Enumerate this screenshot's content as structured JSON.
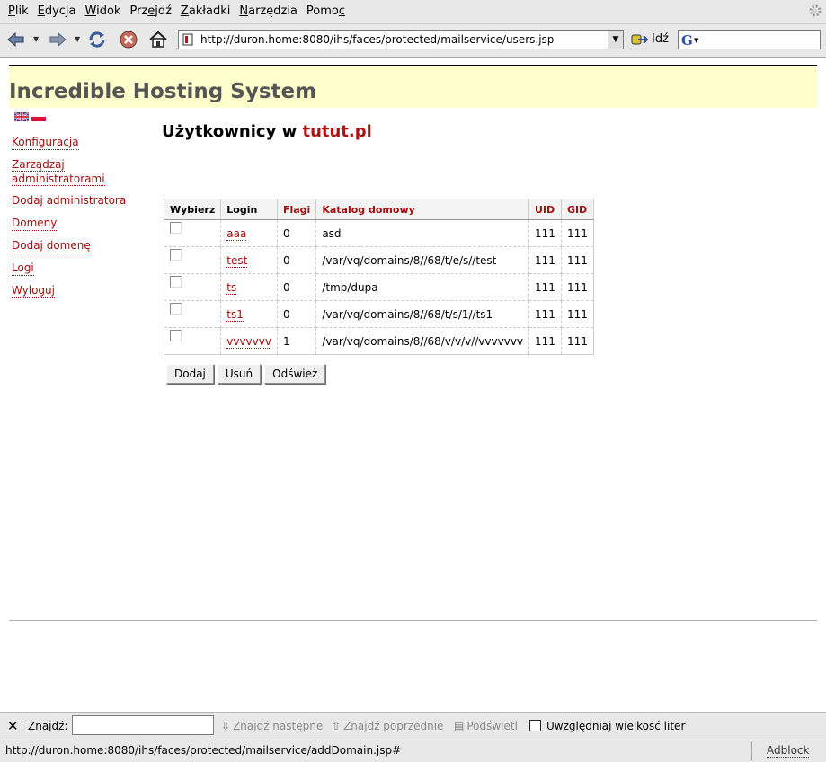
{
  "browser": {
    "menu": [
      {
        "pre": "",
        "u": "P",
        "post": "lik"
      },
      {
        "pre": "",
        "u": "E",
        "post": "dycja"
      },
      {
        "pre": "",
        "u": "W",
        "post": "idok"
      },
      {
        "pre": "Prz",
        "u": "e",
        "post": "jdź"
      },
      {
        "pre": "",
        "u": "Z",
        "post": "akładki"
      },
      {
        "pre": "",
        "u": "N",
        "post": "arzędzia"
      },
      {
        "pre": "Pomo",
        "u": "c",
        "post": ""
      }
    ],
    "url": "http://duron.home:8080/ihs/faces/protected/mailservice/users.jsp",
    "go_label": "Idź",
    "search_engine_glyph": "G",
    "icons": [
      "back-icon",
      "forward-icon",
      "reload-icon",
      "stop-icon",
      "home-icon",
      "throbber-icon"
    ]
  },
  "site": {
    "title": "Incredible Hosting System",
    "languages": [
      "en",
      "pl"
    ]
  },
  "sidebar": {
    "items": [
      {
        "label": "Konfiguracja",
        "name": "konfiguracja"
      },
      {
        "label": "Zarządzaj administratorami",
        "name": "zarzadzaj-administratorami"
      },
      {
        "label": "Dodaj administratora",
        "name": "dodaj-administratora"
      },
      {
        "label": "Domeny",
        "name": "domeny"
      },
      {
        "label": "Dodaj domenę",
        "name": "dodaj-domene"
      },
      {
        "label": "Logi",
        "name": "logi"
      },
      {
        "label": "Wyloguj",
        "name": "wyloguj"
      }
    ]
  },
  "main": {
    "title_prefix": "Użytkownicy w ",
    "domain": "tutut.pl",
    "columns": [
      "Wybierz",
      "Login",
      "Flagi",
      "Katalog domowy",
      "UID",
      "GID"
    ],
    "rows": [
      {
        "login": "aaa",
        "flags": "0",
        "home": "asd",
        "uid": "111",
        "gid": "111"
      },
      {
        "login": "test",
        "flags": "0",
        "home": "/var/vq/domains/8//68/t/e/s//test",
        "uid": "111",
        "gid": "111"
      },
      {
        "login": "ts",
        "flags": "0",
        "home": "/tmp/dupa",
        "uid": "111",
        "gid": "111"
      },
      {
        "login": "ts1",
        "flags": "0",
        "home": "/var/vq/domains/8//68/t/s/1//ts1",
        "uid": "111",
        "gid": "111"
      },
      {
        "login": "vvvvvvv",
        "flags": "1",
        "home": "/var/vq/domains/8//68/v/v/v//vvvvvvv",
        "uid": "111",
        "gid": "111"
      }
    ],
    "buttons": {
      "add": "Dodaj",
      "remove": "Usuń",
      "refresh": "Odśwież"
    }
  },
  "findbar": {
    "label": "Znajdź:",
    "value": "",
    "next": "Znajdź następne",
    "prev": "Znajdź poprzednie",
    "highlight": "Podświetl",
    "match_case": "Uwzględniaj wielkość liter"
  },
  "status": {
    "text": "http://duron.home:8080/ihs/faces/protected/mailservice/addDomain.jsp#",
    "adblock": "Adblock"
  }
}
